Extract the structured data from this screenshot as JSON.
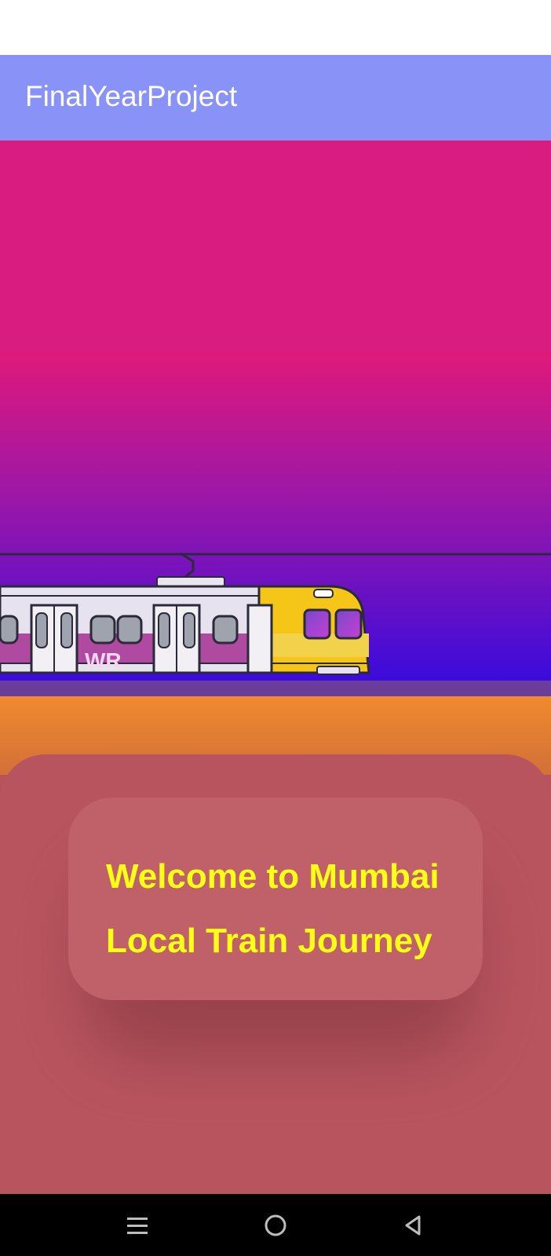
{
  "app": {
    "title": "FinalYearProject"
  },
  "hero": {
    "train_label": "WR"
  },
  "welcome": {
    "line1": "Welcome to Mumbai",
    "line2": "Local Train Journey"
  },
  "navigation": {
    "recents_icon": "recents-icon",
    "home_icon": "home-icon",
    "back_icon": "back-icon"
  },
  "colors": {
    "app_bar": "#8892f7",
    "hero_top": "#d81c80",
    "background": "#b6535d",
    "welcome_text": "#ffff16"
  }
}
